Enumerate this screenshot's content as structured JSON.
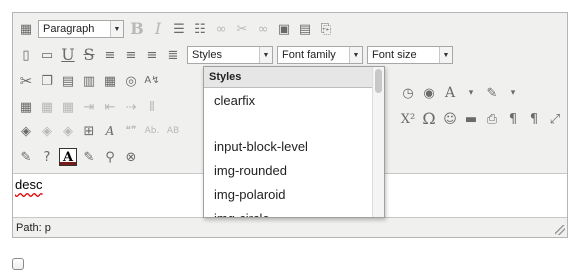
{
  "toolbar": {
    "format_select": {
      "value": "Paragraph"
    },
    "styles_select": {
      "value": "Styles"
    },
    "font_family_select": {
      "value": "Font family"
    },
    "font_size_select": {
      "value": "Font size"
    },
    "icons": {
      "row1": [
        "toggle-toolbar-icon",
        "bold-icon",
        "italic-icon",
        "bullet-list-icon",
        "numbered-list-icon",
        "link-icon",
        "unlink-icon",
        "anchor-icon",
        "image-icon",
        "media-icon",
        "template-icon"
      ],
      "row2": [
        "new-document-icon",
        "save-icon",
        "underline-icon",
        "strikethrough-icon",
        "align-left-icon",
        "align-center-icon",
        "align-right-icon",
        "justify-icon"
      ],
      "row3": [
        "cut-icon",
        "copy-icon",
        "paste-icon",
        "paste-text-icon",
        "paste-word-icon",
        "find-icon",
        "replace-icon",
        "clock-icon",
        "preview-icon",
        "text-color-icon",
        "highlight-color-icon"
      ],
      "row4": [
        "table-icon",
        "table-row-icon",
        "table-col-icon",
        "insert-row-before-icon",
        "insert-row-after-icon",
        "delete-row-icon",
        "insert-col-icon",
        "superscript-icon",
        "omega-icon",
        "emoticon-icon",
        "horizontal-rule-icon",
        "print-icon",
        "ltr-icon",
        "rtl-icon",
        "fullscreen-icon"
      ],
      "row5": [
        "layer-icon",
        "layer-forward-icon",
        "layer-back-icon",
        "insert-layer-icon",
        "style-props-icon",
        "cite-icon",
        "abbr-icon",
        "acronym-icon"
      ],
      "row6": [
        "cleanup-icon",
        "help-icon",
        "font-style-icon",
        "spellcheck-icon",
        "binoculars-icon",
        "remove-format-icon"
      ]
    },
    "glyphs": {
      "superscript": "X²",
      "omega": "Ω",
      "ab": "Ab.",
      "ab2": "AB",
      "a_label": "A"
    }
  },
  "styles_dropdown": {
    "header": "Styles",
    "items": [
      "clearfix",
      "",
      "input-block-level",
      "img-rounded",
      "img-polaroid",
      "img-circle"
    ]
  },
  "editor": {
    "content": "desc",
    "path_label": "Path: p"
  }
}
